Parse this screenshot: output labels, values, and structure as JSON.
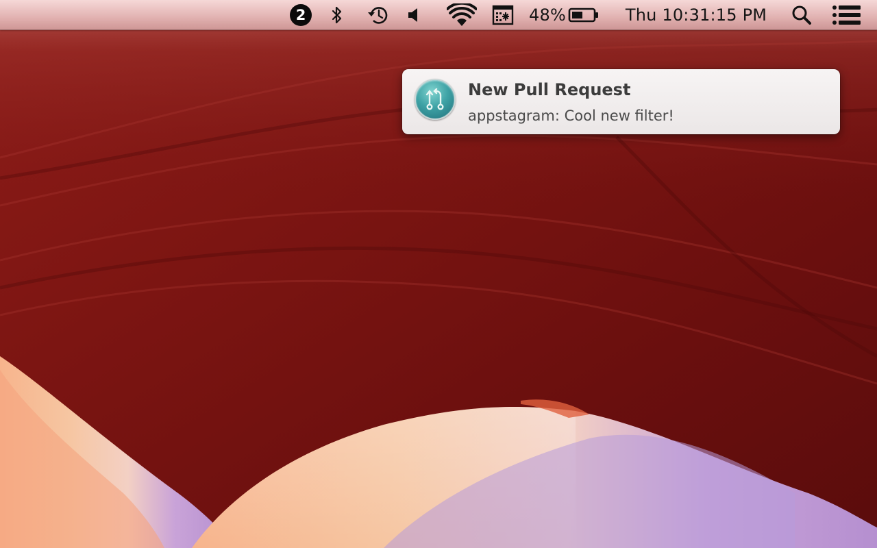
{
  "menubar": {
    "notification_count": "2",
    "battery_percent": "48%",
    "clock": "Thu 10:31:15 PM",
    "icons": [
      "notification-badge",
      "bluetooth-icon",
      "time-machine-icon",
      "volume-icon",
      "wifi-icon",
      "display-icon",
      "battery-icon",
      "spotlight-icon",
      "notification-center-icon"
    ]
  },
  "notification": {
    "icon": "pull-request-icon",
    "title": "New Pull Request",
    "body": "appstagram: Cool new filter!"
  },
  "colors": {
    "menubar_tint": "#e8c4c4",
    "wallpaper_red": "#7a1414",
    "notification_bg": "#f2efef",
    "app_icon_teal": "#3fa3a6"
  }
}
